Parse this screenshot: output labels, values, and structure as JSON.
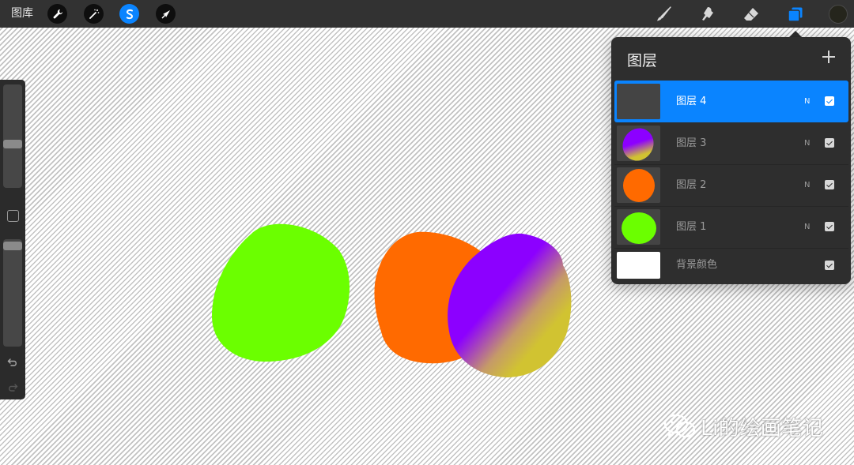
{
  "topbar": {
    "gallery_label": "图库",
    "left_tools": [
      {
        "name": "wrench-icon",
        "active": false
      },
      {
        "name": "magic-wand-icon",
        "active": false
      },
      {
        "name": "selection-s-icon",
        "active": true
      },
      {
        "name": "transform-arrow-icon",
        "active": false
      }
    ],
    "right_tools": [
      "brush-icon",
      "smudge-icon",
      "eraser-icon",
      "layers-icon"
    ],
    "current_color": "#25251c",
    "accent_color": "#0a84ff"
  },
  "sidebar": {
    "brush_size_level": 0.56,
    "opacity_level": 0.98,
    "buttons": [
      "modify-square-icon",
      "undo-icon",
      "redo-icon"
    ]
  },
  "canvas": {
    "blob_colors": {
      "green": "#6bff00",
      "orange": "#ff6a00",
      "purple": "#8c00ff",
      "yellow": "#d1c331"
    }
  },
  "layers_panel": {
    "title": "图层",
    "add_icon": "plus-icon",
    "layers": [
      {
        "name": "图层 4",
        "blend": "N",
        "visible": true,
        "active": true,
        "thumb": "empty"
      },
      {
        "name": "图层 3",
        "blend": "N",
        "visible": true,
        "active": false,
        "thumb": "purple-yellow-blob"
      },
      {
        "name": "图层 2",
        "blend": "N",
        "visible": true,
        "active": false,
        "thumb": "orange-blob"
      },
      {
        "name": "图层 1",
        "blend": "N",
        "visible": true,
        "active": false,
        "thumb": "green-blob"
      }
    ],
    "background": {
      "name": "背景颜色",
      "visible": true,
      "color": "#ffffff"
    }
  },
  "watermark": {
    "text": "Li的绘画笔记",
    "icon": "wechat-icon"
  }
}
